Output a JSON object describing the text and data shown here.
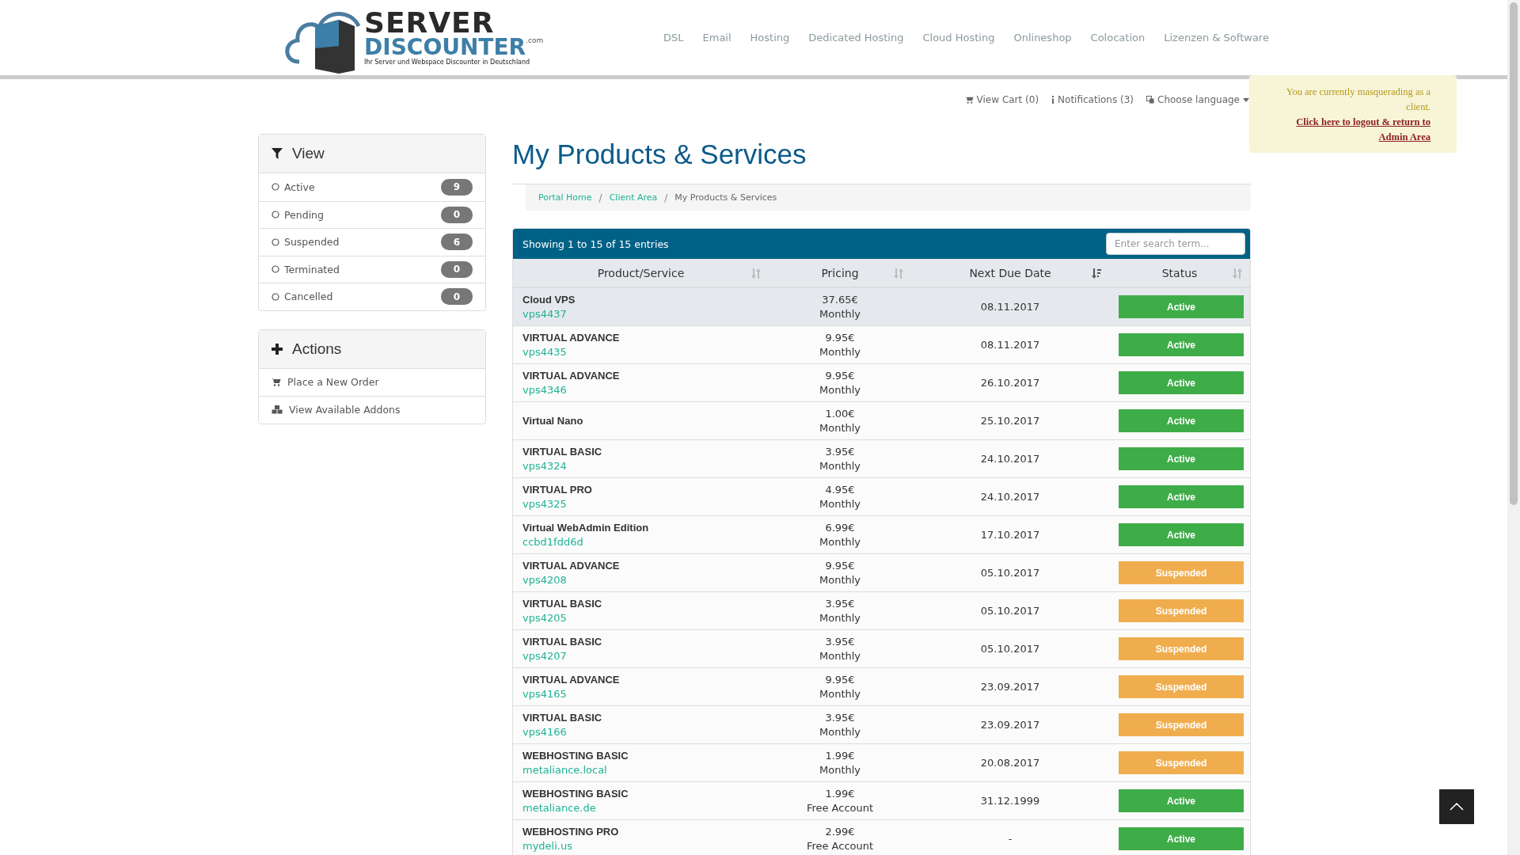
{
  "logo": {
    "line_1": "SERVER",
    "line_2": "DISCOUNTER",
    "suffix": ".com",
    "tagline": "Ihr Server und Webspace Discounter in Deutschland"
  },
  "nav": [
    "DSL",
    "Email",
    "Hosting",
    "Dedicated Hosting",
    "Cloud Hosting",
    "Onlineshop",
    "Colocation",
    "Lizenzen & Software"
  ],
  "top_links": {
    "cart": "View Cart (0)",
    "notifications": "Notifications (3)",
    "language": "Choose language"
  },
  "masquerade": {
    "message": "You are currently masquerading as a client.",
    "link": "Click here to logout & return to Admin Area"
  },
  "sidebar": {
    "view": {
      "title": "View",
      "items": [
        {
          "label": "Active",
          "count": "9"
        },
        {
          "label": "Pending",
          "count": "0"
        },
        {
          "label": "Suspended",
          "count": "6"
        },
        {
          "label": "Terminated",
          "count": "0"
        },
        {
          "label": "Cancelled",
          "count": "0"
        }
      ]
    },
    "actions": {
      "title": "Actions",
      "items": [
        {
          "label": "Place a New Order",
          "kind": "cart"
        },
        {
          "label": "View Available Addons",
          "kind": "addons"
        }
      ]
    }
  },
  "page_title": "My Products & Services",
  "breadcrumb": [
    {
      "label": "Portal Home",
      "link": true
    },
    {
      "separator": "/",
      "label": "Client Area",
      "link": true
    },
    {
      "separator": "/",
      "label": "My Products & Services",
      "link": false
    }
  ],
  "table": {
    "info": "Showing 1 to 15 of 15 entries",
    "search": {
      "placeholder": "Enter search term..."
    },
    "columns": [
      {
        "label": "Product/Service",
        "sorted": false
      },
      {
        "label": "Pricing",
        "sorted": false
      },
      {
        "label": "Next Due Date",
        "sorted": true
      },
      {
        "label": "Status",
        "sorted": false
      }
    ],
    "rows": [
      {
        "product": "Cloud VPS",
        "domain": "vps4437",
        "price": "37.65€",
        "cycle": "Monthly",
        "due": "08.11.2017",
        "status": "Active",
        "kind": "active",
        "highlighted": true
      },
      {
        "product": "VIRTUAL ADVANCE",
        "domain": "vps4435",
        "price": "9.95€",
        "cycle": "Monthly",
        "due": "08.11.2017",
        "status": "Active",
        "kind": "active",
        "highlighted": false
      },
      {
        "product": "VIRTUAL ADVANCE",
        "domain": "vps4346",
        "price": "9.95€",
        "cycle": "Monthly",
        "due": "26.10.2017",
        "status": "Active",
        "kind": "active",
        "highlighted": false
      },
      {
        "product": "Virtual Nano",
        "price": "1.00€",
        "cycle": "Monthly",
        "due": "25.10.2017",
        "status": "Active",
        "kind": "active",
        "highlighted": false
      },
      {
        "product": "VIRTUAL BASIC",
        "domain": "vps4324",
        "price": "3.95€",
        "cycle": "Monthly",
        "due": "24.10.2017",
        "status": "Active",
        "kind": "active",
        "highlighted": false
      },
      {
        "product": "VIRTUAL PRO",
        "domain": "vps4325",
        "price": "4.95€",
        "cycle": "Monthly",
        "due": "24.10.2017",
        "status": "Active",
        "kind": "active",
        "highlighted": false
      },
      {
        "product": "Virtual WebAdmin Edition",
        "domain": "ccbd1fdd6d",
        "price": "6.99€",
        "cycle": "Monthly",
        "due": "17.10.2017",
        "status": "Active",
        "kind": "active",
        "highlighted": false
      },
      {
        "product": "VIRTUAL ADVANCE",
        "domain": "vps4208",
        "price": "9.95€",
        "cycle": "Monthly",
        "due": "05.10.2017",
        "status": "Suspended",
        "kind": "suspended",
        "highlighted": false
      },
      {
        "product": "VIRTUAL BASIC",
        "domain": "vps4205",
        "price": "3.95€",
        "cycle": "Monthly",
        "due": "05.10.2017",
        "status": "Suspended",
        "kind": "suspended",
        "highlighted": false
      },
      {
        "product": "VIRTUAL BASIC",
        "domain": "vps4207",
        "price": "3.95€",
        "cycle": "Monthly",
        "due": "05.10.2017",
        "status": "Suspended",
        "kind": "suspended",
        "highlighted": false
      },
      {
        "product": "VIRTUAL ADVANCE",
        "domain": "vps4165",
        "price": "9.95€",
        "cycle": "Monthly",
        "due": "23.09.2017",
        "status": "Suspended",
        "kind": "suspended",
        "highlighted": false
      },
      {
        "product": "VIRTUAL BASIC",
        "domain": "vps4166",
        "price": "3.95€",
        "cycle": "Monthly",
        "due": "23.09.2017",
        "status": "Suspended",
        "kind": "suspended",
        "highlighted": false
      },
      {
        "product": "WEBHOSTING BASIC",
        "domain": "metaliance.local",
        "price": "1.99€",
        "cycle": "Monthly",
        "due": "20.08.2017",
        "status": "Suspended",
        "kind": "suspended",
        "highlighted": false
      },
      {
        "product": "WEBHOSTING BASIC",
        "domain": "metaliance.de",
        "price": "1.99€",
        "cycle": "Free Account",
        "due": "31.12.1999",
        "status": "Active",
        "kind": "active",
        "highlighted": false
      },
      {
        "product": "WEBHOSTING PRO",
        "domain": "mydeli.us",
        "price": "2.99€",
        "cycle": "Free Account",
        "due": "-",
        "status": "Active",
        "kind": "active",
        "highlighted": false
      }
    ]
  }
}
